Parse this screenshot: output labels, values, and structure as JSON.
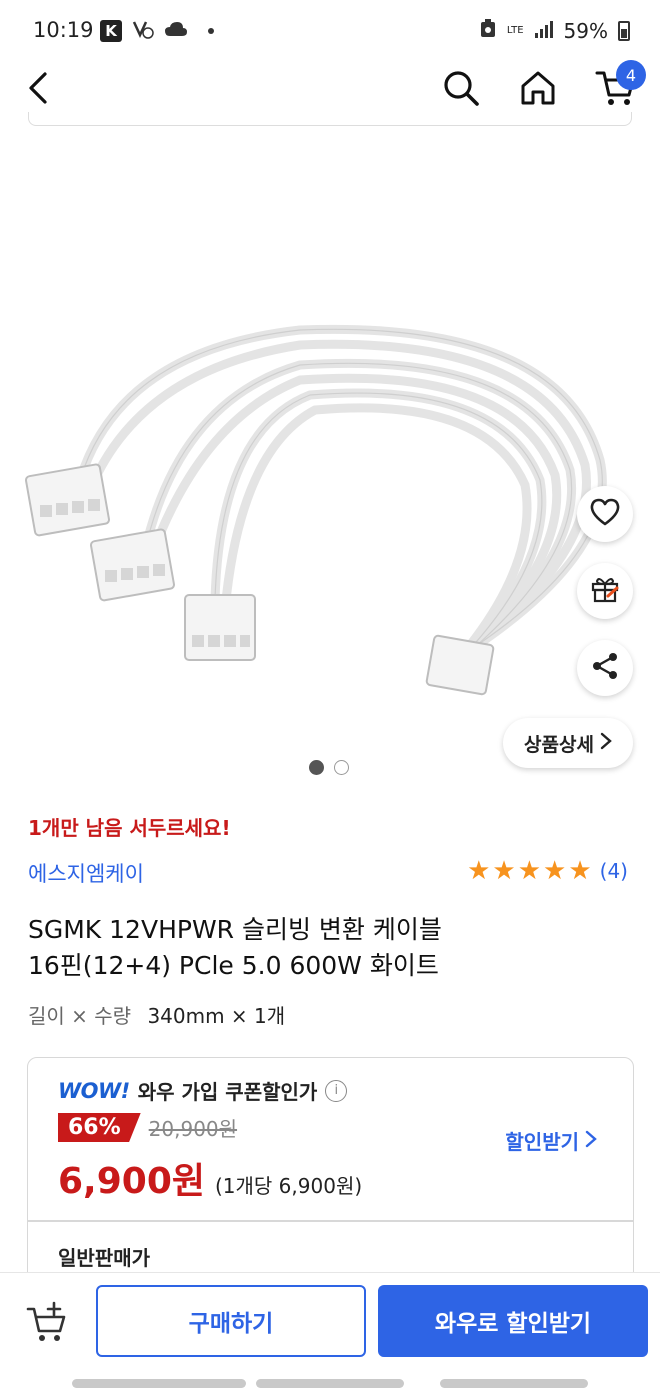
{
  "status_bar": {
    "time": "10:19",
    "k_badge": "K",
    "network": "LTE",
    "battery": "59%"
  },
  "nav": {
    "cart_count": "4"
  },
  "gallery": {
    "detail_label": "상품상세",
    "current_page": 1,
    "total_pages": 2
  },
  "product": {
    "stock_notice": "1개만 남음 서두르세요!",
    "brand": "에스지엠케이",
    "rating_count": "(4)",
    "rating_stars": 5,
    "title_line1": "SGMK 12VHPWR 슬리빙 변환 케이블",
    "title_line2": "16핀(12+4) PCle 5.0 600W 화이트",
    "option_label": "길이 × 수량",
    "option_value": "340mm × 1개"
  },
  "pricing": {
    "wow_logo": "WOW!",
    "wow_label": "와우 가입 쿠폰할인가",
    "discount_rate": "66%",
    "original_price": "20,900원",
    "sale_price": "6,900원",
    "unit_price": "(1개당 6,900원)",
    "get_discount_label": "할인받기",
    "normal_price_label": "일반판매가"
  },
  "bottom": {
    "buy_label": "구매하기",
    "wow_discount_label": "와우로 할인받기"
  },
  "colors": {
    "accent_blue": "#2e64e5",
    "sale_red": "#c81a1a",
    "star_orange": "#f7931e"
  }
}
